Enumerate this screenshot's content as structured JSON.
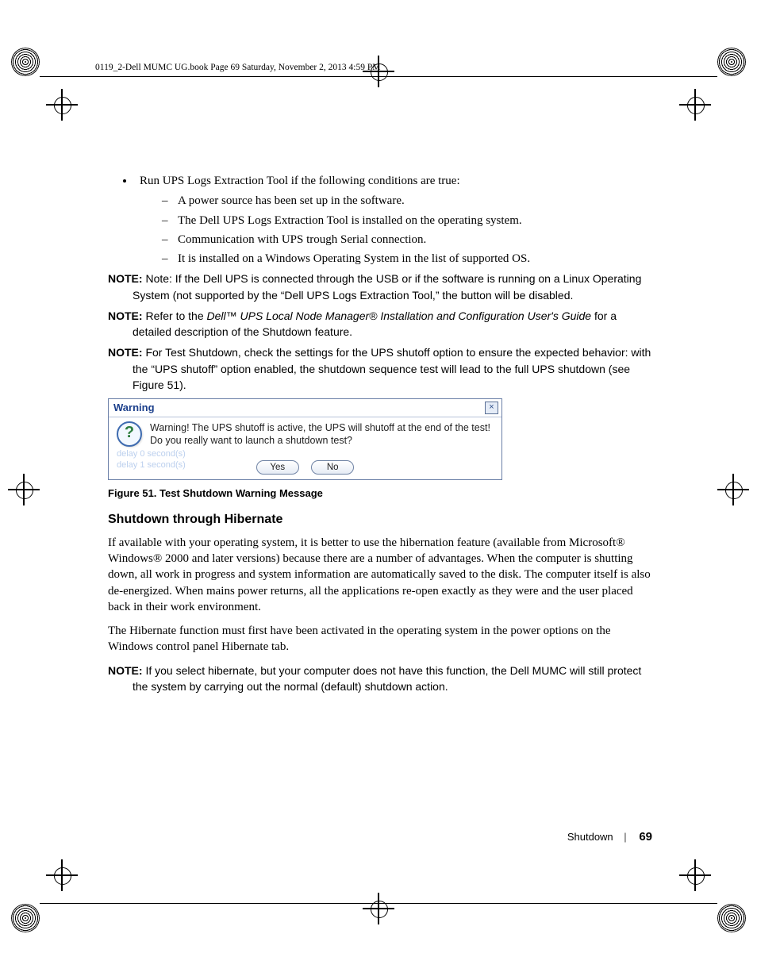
{
  "header_slug": "0119_2-Dell MUMC UG.book  Page 69  Saturday, November 2, 2013  4:59 PM",
  "bullets": {
    "main": "Run UPS Logs Extraction Tool if the following conditions are true:",
    "sub": [
      "A power source has been set up in the software.",
      "The Dell UPS Logs Extraction Tool is installed on the operating system.",
      "Communication with UPS trough Serial connection.",
      "It is installed on a Windows Operating System in the list of supported OS."
    ]
  },
  "notes": {
    "n1_label": "NOTE: ",
    "n1_body": "Note: If the Dell UPS is connected through the USB or if the software is running on a Linux Operating System (not supported by the “Dell UPS Logs Extraction Tool,” the button will be disabled.",
    "n2_label": "NOTE: ",
    "n2_prefix": "Refer to the ",
    "n2_ital": "Dell™ UPS Local Node Manager® Installation and Configuration User's Guide",
    "n2_suffix": " for a detailed description of the Shutdown feature.",
    "n3_label": "NOTE: ",
    "n3_body": "For Test Shutdown, check the settings for the UPS shutoff option to ensure the expected behavior: with the “UPS shutoff” option enabled, the shutdown sequence test will lead to the full UPS shutdown (see Figure 51).",
    "n4_label": "NOTE: ",
    "n4_body": "If you select hibernate, but your computer does not have this function, the Dell MUMC will still protect the system by carrying out the normal (default) shutdown action."
  },
  "dialog": {
    "title": "Warning",
    "close": "×",
    "q": "?",
    "line1": "Warning!  The UPS shutoff is active, the UPS will shutoff at the end of the test!",
    "line2": "Do you really want to launch a shutdown test?",
    "faded1": "delay  0 second(s)",
    "faded2": "delay  1 second(s)",
    "yes": "Yes",
    "no": "No"
  },
  "figure_caption": "Figure 51.  Test Shutdown Warning Message",
  "section_heading": "Shutdown through Hibernate",
  "para1": "If available with your operating system, it is better to use the hibernation feature (available from Microsoft® Windows® 2000 and later versions) because there are a number of advantages. When the computer is shutting down, all work in progress and system information are automatically saved to the disk. The computer itself is also de-energized. When mains power returns, all the applications re-open exactly as they were and the user placed back in their work environment.",
  "para2": "The Hibernate function must first have been activated in the operating system in the power options on the Windows control panel Hibernate tab.",
  "footer": {
    "section": "Shutdown",
    "page": "69"
  }
}
